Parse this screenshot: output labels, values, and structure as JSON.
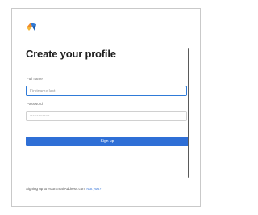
{
  "page": {
    "title": "Create your profile"
  },
  "form": {
    "name_label": "Full name",
    "name_value": "Firstname last",
    "password_label": "Password",
    "password_value": "••••••••••••••",
    "submit_label": "Sign up"
  },
  "footer": {
    "text": "Signing up to YourEmailAddress.com",
    "link": "Not you?"
  },
  "colors": {
    "accent": "#2f6fd6",
    "logo_orange": "#f08a2a",
    "logo_blue": "#2f7bd8"
  }
}
